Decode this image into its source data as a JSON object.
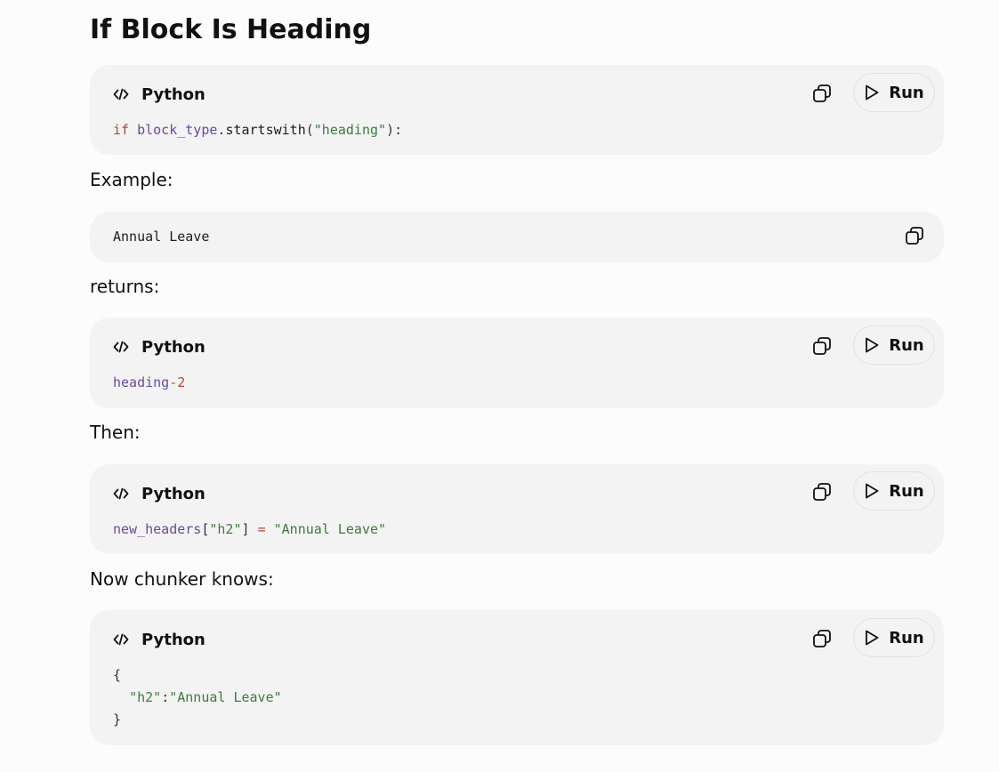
{
  "document": {
    "heading": "If Block Is Heading"
  },
  "paragraphs": {
    "example": "Example:",
    "returns": "returns:",
    "then": "Then:",
    "chunker": "Now chunker knows:"
  },
  "blocks": {
    "block1": {
      "language": "Python",
      "run_label": "Run",
      "code": {
        "kw_if": "if",
        "var_block_type": "block_type",
        "punct_dot": ".",
        "method_startswith": "startswith",
        "punct_open": "(",
        "str_heading": "\"heading\"",
        "punct_close": "):"
      }
    },
    "block2": {
      "code": "Annual Leave"
    },
    "block3": {
      "language": "Python",
      "run_label": "Run",
      "code": {
        "var_heading": "heading",
        "op_dash": "-",
        "num_2": "2"
      }
    },
    "block4": {
      "language": "Python",
      "run_label": "Run",
      "code": {
        "var_new_headers": "new_headers",
        "punct_lbracket": "[",
        "str_h2": "\"h2\"",
        "punct_rbracket": "]",
        "op_equals": "=",
        "str_annual": "\"Annual Leave\""
      }
    },
    "block5": {
      "language": "Python",
      "run_label": "Run",
      "code": {
        "brace_open": "{",
        "str_h2": "\"h2\"",
        "punct_colon": ":",
        "str_annual": "\"Annual Leave\"",
        "brace_close": "}"
      }
    }
  },
  "icons": {
    "code": "code-icon",
    "copy": "copy-icon",
    "play": "play-icon"
  },
  "colors": {
    "background": "#fcfcfc",
    "code_background": "#f3f3f3",
    "keyword": "#a24a3a",
    "variable": "#6a4a9b",
    "string": "#3d7b3d",
    "operator": "#b34a3d"
  }
}
